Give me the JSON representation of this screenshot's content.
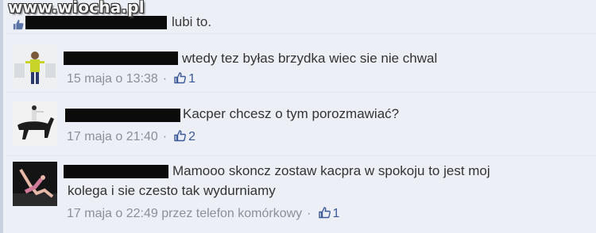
{
  "watermark": "www.wiocha.pl",
  "likes_summary": {
    "text": "lubi to."
  },
  "comments": [
    {
      "text": "wtedy tez byłas brzydka wiec sie nie chwal",
      "date": "15 maja o 13:38",
      "likes": "1"
    },
    {
      "text": "Kacper chcesz o tym porozmawiać?",
      "date": "17 maja o 21:40",
      "likes": "2"
    },
    {
      "text_line1": "Mamooo skoncz zostaw kacpra w spokoju to jest moj",
      "text_line2": "kolega i sie czesto tak wydurniamy",
      "date": "17 maja o 22:49",
      "via": "przez telefon komórkowy",
      "likes": "1"
    }
  ],
  "colors": {
    "background": "#eceff5",
    "link": "#3b5998",
    "meta": "#8a8f99",
    "redaction": "#0b0b0b"
  },
  "icons": [
    "thumbs-up-icon"
  ]
}
